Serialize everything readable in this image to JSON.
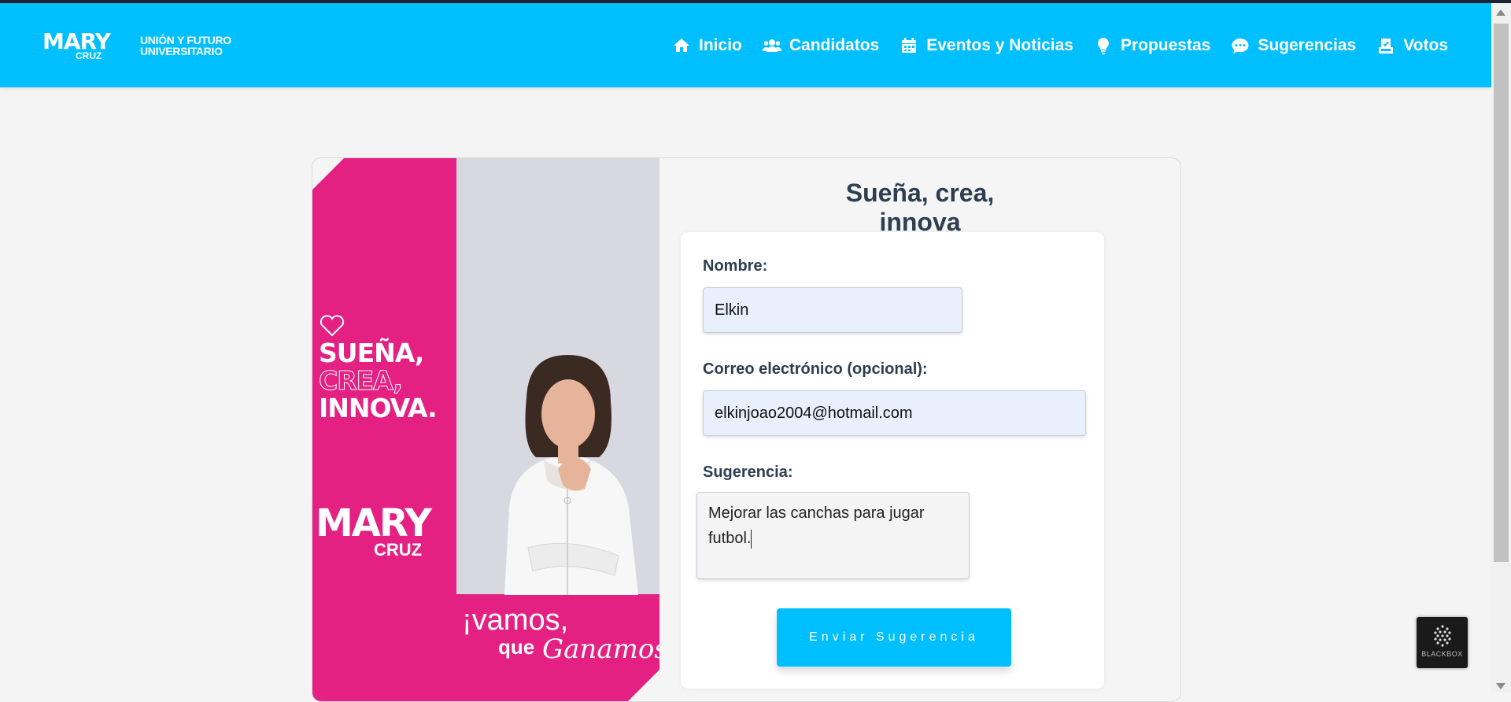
{
  "brand": {
    "name_top": "MARY",
    "name_bottom": "CRUZ",
    "slogan_line1": "UNIÓN Y FUTURO",
    "slogan_line2": "UNIVERSITARIO"
  },
  "nav": {
    "items": [
      {
        "label": "Inicio",
        "icon": "home-icon"
      },
      {
        "label": "Candidatos",
        "icon": "users-icon"
      },
      {
        "label": "Eventos y Noticias",
        "icon": "calendar-icon"
      },
      {
        "label": "Propuestas",
        "icon": "lightbulb-icon"
      },
      {
        "label": "Sugerencias",
        "icon": "chat-icon"
      },
      {
        "label": "Votos",
        "icon": "vote-icon"
      }
    ]
  },
  "poster": {
    "line1": "SUEÑA,",
    "line2": "CREA,",
    "line3": "INNOVA.",
    "name_top": "MARY",
    "name_bottom": "CRUZ",
    "vamos": "¡vamos,",
    "que": "que",
    "ganamos": "Ganamos!."
  },
  "form": {
    "title": "Sueña, crea, innova",
    "name_label": "Nombre:",
    "name_value": "Elkin",
    "email_label": "Correo electrónico (opcional):",
    "email_value": "elkinjoao2004@hotmail.com",
    "suggestion_label": "Sugerencia:",
    "suggestion_value": "Mejorar las canchas para jugar futbol.",
    "submit_label": "Enviar Sugerencia"
  },
  "widget": {
    "label": "BLACKBOX"
  },
  "colors": {
    "accent": "#00bfff",
    "pink": "#e52083",
    "title": "#2c3e50"
  }
}
